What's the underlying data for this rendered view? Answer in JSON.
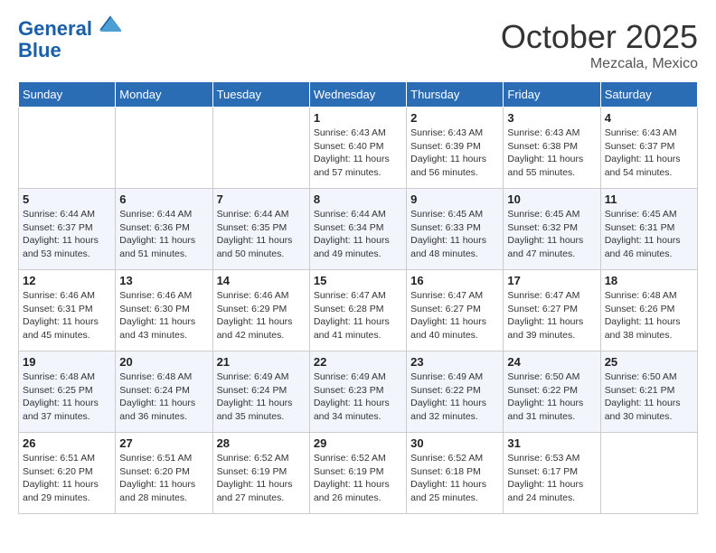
{
  "header": {
    "logo_line1": "General",
    "logo_line2": "Blue",
    "month": "October 2025",
    "location": "Mezcala, Mexico"
  },
  "days_of_week": [
    "Sunday",
    "Monday",
    "Tuesday",
    "Wednesday",
    "Thursday",
    "Friday",
    "Saturday"
  ],
  "weeks": [
    [
      {
        "day": "",
        "info": ""
      },
      {
        "day": "",
        "info": ""
      },
      {
        "day": "",
        "info": ""
      },
      {
        "day": "1",
        "info": "Sunrise: 6:43 AM\nSunset: 6:40 PM\nDaylight: 11 hours\nand 57 minutes."
      },
      {
        "day": "2",
        "info": "Sunrise: 6:43 AM\nSunset: 6:39 PM\nDaylight: 11 hours\nand 56 minutes."
      },
      {
        "day": "3",
        "info": "Sunrise: 6:43 AM\nSunset: 6:38 PM\nDaylight: 11 hours\nand 55 minutes."
      },
      {
        "day": "4",
        "info": "Sunrise: 6:43 AM\nSunset: 6:37 PM\nDaylight: 11 hours\nand 54 minutes."
      }
    ],
    [
      {
        "day": "5",
        "info": "Sunrise: 6:44 AM\nSunset: 6:37 PM\nDaylight: 11 hours\nand 53 minutes."
      },
      {
        "day": "6",
        "info": "Sunrise: 6:44 AM\nSunset: 6:36 PM\nDaylight: 11 hours\nand 51 minutes."
      },
      {
        "day": "7",
        "info": "Sunrise: 6:44 AM\nSunset: 6:35 PM\nDaylight: 11 hours\nand 50 minutes."
      },
      {
        "day": "8",
        "info": "Sunrise: 6:44 AM\nSunset: 6:34 PM\nDaylight: 11 hours\nand 49 minutes."
      },
      {
        "day": "9",
        "info": "Sunrise: 6:45 AM\nSunset: 6:33 PM\nDaylight: 11 hours\nand 48 minutes."
      },
      {
        "day": "10",
        "info": "Sunrise: 6:45 AM\nSunset: 6:32 PM\nDaylight: 11 hours\nand 47 minutes."
      },
      {
        "day": "11",
        "info": "Sunrise: 6:45 AM\nSunset: 6:31 PM\nDaylight: 11 hours\nand 46 minutes."
      }
    ],
    [
      {
        "day": "12",
        "info": "Sunrise: 6:46 AM\nSunset: 6:31 PM\nDaylight: 11 hours\nand 45 minutes."
      },
      {
        "day": "13",
        "info": "Sunrise: 6:46 AM\nSunset: 6:30 PM\nDaylight: 11 hours\nand 43 minutes."
      },
      {
        "day": "14",
        "info": "Sunrise: 6:46 AM\nSunset: 6:29 PM\nDaylight: 11 hours\nand 42 minutes."
      },
      {
        "day": "15",
        "info": "Sunrise: 6:47 AM\nSunset: 6:28 PM\nDaylight: 11 hours\nand 41 minutes."
      },
      {
        "day": "16",
        "info": "Sunrise: 6:47 AM\nSunset: 6:27 PM\nDaylight: 11 hours\nand 40 minutes."
      },
      {
        "day": "17",
        "info": "Sunrise: 6:47 AM\nSunset: 6:27 PM\nDaylight: 11 hours\nand 39 minutes."
      },
      {
        "day": "18",
        "info": "Sunrise: 6:48 AM\nSunset: 6:26 PM\nDaylight: 11 hours\nand 38 minutes."
      }
    ],
    [
      {
        "day": "19",
        "info": "Sunrise: 6:48 AM\nSunset: 6:25 PM\nDaylight: 11 hours\nand 37 minutes."
      },
      {
        "day": "20",
        "info": "Sunrise: 6:48 AM\nSunset: 6:24 PM\nDaylight: 11 hours\nand 36 minutes."
      },
      {
        "day": "21",
        "info": "Sunrise: 6:49 AM\nSunset: 6:24 PM\nDaylight: 11 hours\nand 35 minutes."
      },
      {
        "day": "22",
        "info": "Sunrise: 6:49 AM\nSunset: 6:23 PM\nDaylight: 11 hours\nand 34 minutes."
      },
      {
        "day": "23",
        "info": "Sunrise: 6:49 AM\nSunset: 6:22 PM\nDaylight: 11 hours\nand 32 minutes."
      },
      {
        "day": "24",
        "info": "Sunrise: 6:50 AM\nSunset: 6:22 PM\nDaylight: 11 hours\nand 31 minutes."
      },
      {
        "day": "25",
        "info": "Sunrise: 6:50 AM\nSunset: 6:21 PM\nDaylight: 11 hours\nand 30 minutes."
      }
    ],
    [
      {
        "day": "26",
        "info": "Sunrise: 6:51 AM\nSunset: 6:20 PM\nDaylight: 11 hours\nand 29 minutes."
      },
      {
        "day": "27",
        "info": "Sunrise: 6:51 AM\nSunset: 6:20 PM\nDaylight: 11 hours\nand 28 minutes."
      },
      {
        "day": "28",
        "info": "Sunrise: 6:52 AM\nSunset: 6:19 PM\nDaylight: 11 hours\nand 27 minutes."
      },
      {
        "day": "29",
        "info": "Sunrise: 6:52 AM\nSunset: 6:19 PM\nDaylight: 11 hours\nand 26 minutes."
      },
      {
        "day": "30",
        "info": "Sunrise: 6:52 AM\nSunset: 6:18 PM\nDaylight: 11 hours\nand 25 minutes."
      },
      {
        "day": "31",
        "info": "Sunrise: 6:53 AM\nSunset: 6:17 PM\nDaylight: 11 hours\nand 24 minutes."
      },
      {
        "day": "",
        "info": ""
      }
    ]
  ]
}
